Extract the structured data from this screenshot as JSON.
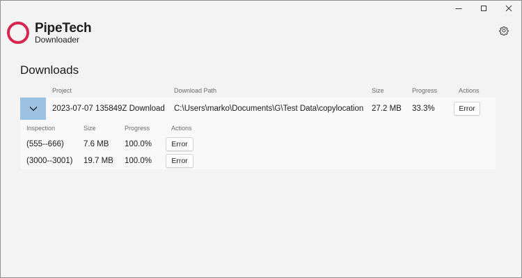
{
  "app": {
    "name": "PipeTech",
    "subtitle": "Downloader",
    "accent_color": "#d7264d"
  },
  "page": {
    "title": "Downloads"
  },
  "downloads_table": {
    "headers": {
      "project": "Project",
      "download_path": "Download Path",
      "size": "Size",
      "progress": "Progress",
      "actions": "Actions"
    },
    "rows": [
      {
        "project": "2023-07-07 135849Z Download",
        "download_path": "C:\\Users\\marko\\Documents\\G\\Test Data\\copylocation",
        "size": "27.2 MB",
        "progress": "33.3%",
        "action_label": "Error",
        "expanded": true
      }
    ]
  },
  "inspections_table": {
    "headers": {
      "inspection": "Inspection",
      "size": "Size",
      "progress": "Progress",
      "actions": "Actions"
    },
    "rows": [
      {
        "inspection": "(555--666)",
        "size": "7.6 MB",
        "progress": "100.0%",
        "action_label": "Error"
      },
      {
        "inspection": "(3000--3001)",
        "size": "19.7 MB",
        "progress": "100.0%",
        "action_label": "Error"
      }
    ]
  },
  "icons": {
    "minimize": "minimize-icon",
    "maximize": "maximize-icon",
    "close": "close-icon",
    "settings": "gear-icon",
    "expander": "chevron-down-icon"
  }
}
